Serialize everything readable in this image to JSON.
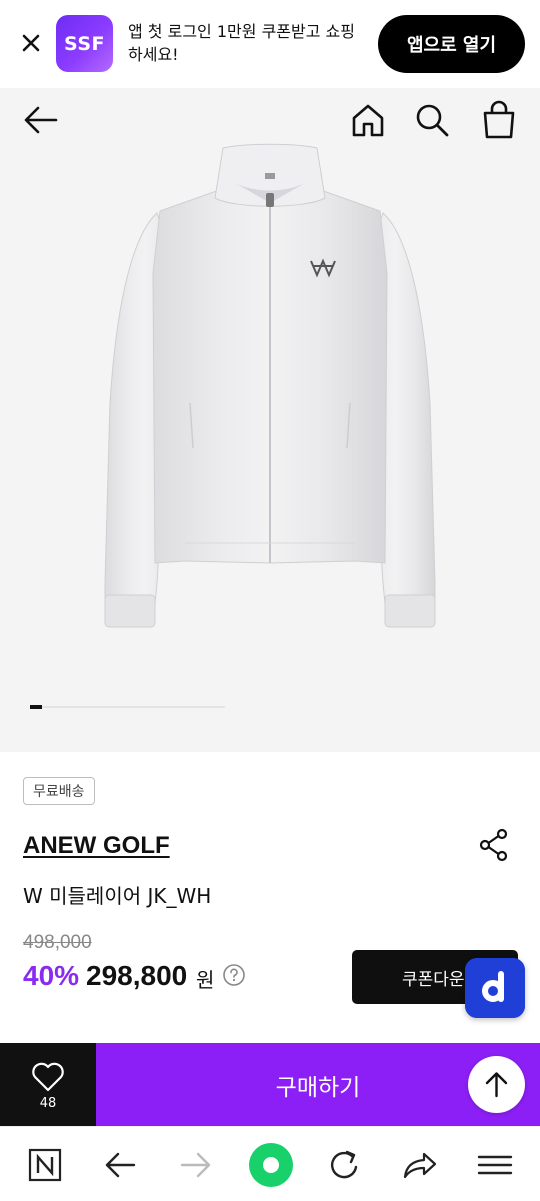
{
  "app_banner": {
    "logo_text": "SSF",
    "message": "앱 첫 로그인 1만원 쿠폰받고 쇼핑하세요!",
    "open_button": "앱으로 열기"
  },
  "product": {
    "badge": "무료배송",
    "brand": "ANEW GOLF",
    "name": "W 미들레이어 JK_WH",
    "original_price": "498,000",
    "discount": "40%",
    "sale_price": "298,800",
    "currency": "원",
    "coupon_button": "쿠폰다운",
    "image_index": 1,
    "image_count": 16
  },
  "purchase_bar": {
    "wish_count": "48",
    "buy_label": "구매하기"
  },
  "colors": {
    "accent": "#8c1ff5",
    "discount": "#8a2cf0",
    "banner_logo": "#7a31f7",
    "d_fab": "#1f3fd6",
    "browser_home": "#19d16b"
  }
}
